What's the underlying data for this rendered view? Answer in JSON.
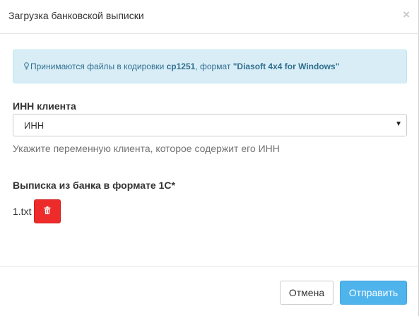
{
  "dialog": {
    "title": "Загрузка банковской выписки",
    "close_label": "×"
  },
  "alert": {
    "icon": "lightbulb-icon",
    "text_prefix": "Принимаются файлы в кодировки ",
    "encoding": "cp1251",
    "text_middle": ", формат ",
    "format": "\"Diasoft 4x4 for Windows\"",
    "colors": {
      "background": "#d9edf7",
      "text": "#31708f"
    }
  },
  "inn_field": {
    "label": "ИНН клиента",
    "selected_value": "ИНН",
    "help_text": "Укажите переменную клиента, которое содержит его ИНН"
  },
  "statement_field": {
    "label": "Выписка из банка в формате 1С*",
    "file_name": "1.txt",
    "delete_icon": "trash-icon"
  },
  "footer": {
    "cancel_label": "Отмена",
    "submit_label": "Отправить",
    "colors": {
      "submit": "#4fb3ec",
      "delete": "#ee2b2b"
    }
  }
}
